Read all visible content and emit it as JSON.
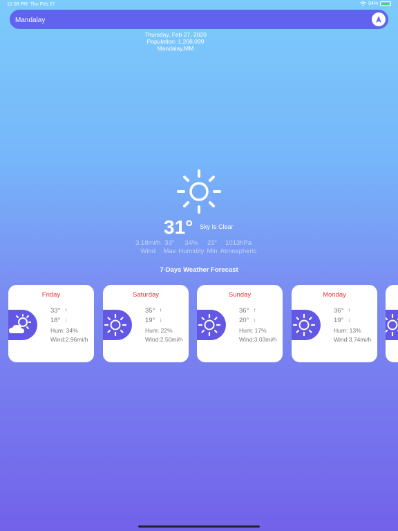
{
  "status": {
    "time": "12:08 PM",
    "date": "Thu Feb 27",
    "battery": "94%"
  },
  "search": {
    "value": "Mandalay"
  },
  "info": {
    "date": "Thursday, Feb 27, 2020",
    "population": "Population: 1,208,099",
    "location": "Mandalay,MM"
  },
  "current": {
    "temp": "31°",
    "condition": "Sky Is Clear",
    "icon": "sun-icon",
    "stats": [
      {
        "value": "3.18mi/h",
        "label": "Wind"
      },
      {
        "value": "33°",
        "label": "Max"
      },
      {
        "value": "34%",
        "label": "Humidity"
      },
      {
        "value": "23°",
        "label": "Min"
      },
      {
        "value": "1013hPa",
        "label": "Atmospheric"
      }
    ]
  },
  "forecast": {
    "title": "7-Days Weather Forecast",
    "days": [
      {
        "day": "Friday",
        "max": "33°",
        "min": "18°",
        "hum": "Hum: 34%",
        "wind": "Wind:2.96mi/h",
        "icon": "partly-cloudy-icon"
      },
      {
        "day": "Saturday",
        "max": "35°",
        "min": "19°",
        "hum": "Hum: 22%",
        "wind": "Wind:2.50mi/h",
        "icon": "sun-icon"
      },
      {
        "day": "Sunday",
        "max": "36°",
        "min": "20°",
        "hum": "Hum: 17%",
        "wind": "Wind:3.03mi/h",
        "icon": "sun-icon"
      },
      {
        "day": "Monday",
        "max": "36°",
        "min": "19°",
        "hum": "Hum: 13%",
        "wind": "Wind:3.74mi/h",
        "icon": "sun-icon"
      }
    ]
  },
  "colors": {
    "accent": "#6358e4",
    "day_label": "#e53935",
    "search_bg": "#5f63ee"
  }
}
